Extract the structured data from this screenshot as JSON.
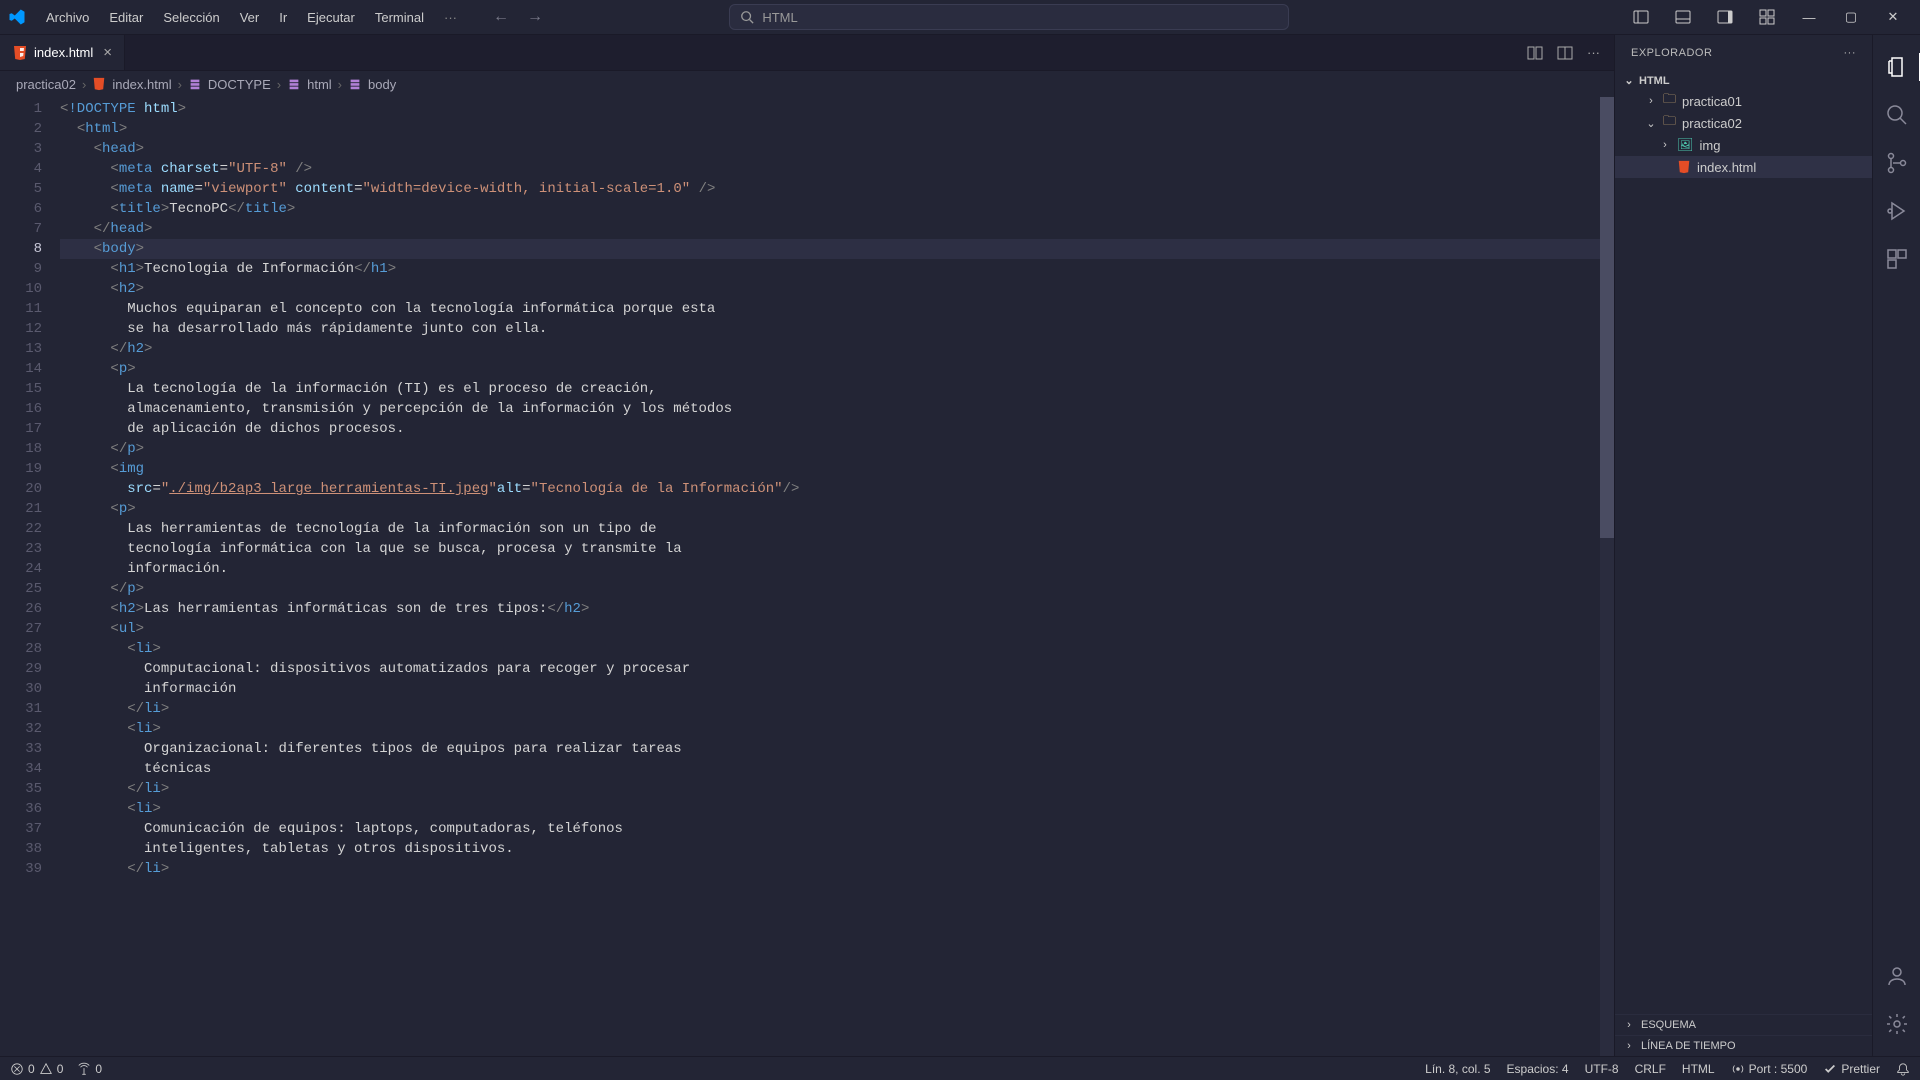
{
  "menu": [
    "Archivo",
    "Editar",
    "Selección",
    "Ver",
    "Ir",
    "Ejecutar",
    "Terminal"
  ],
  "search_placeholder": "HTML",
  "tab": {
    "name": "index.html"
  },
  "breadcrumb": [
    "practica02",
    "index.html",
    "DOCTYPE",
    "html",
    "body"
  ],
  "explorer": {
    "title": "EXPLORADOR",
    "root": "HTML",
    "items": [
      {
        "name": "practica01",
        "type": "folder",
        "expanded": false,
        "indent": 1
      },
      {
        "name": "practica02",
        "type": "folder",
        "expanded": true,
        "indent": 1
      },
      {
        "name": "img",
        "type": "folder-img",
        "expanded": false,
        "indent": 2
      },
      {
        "name": "index.html",
        "type": "html",
        "indent": 2,
        "selected": true
      }
    ],
    "esquema": "ESQUEMA",
    "linea_de_tiempo": "LÍNEA DE TIEMPO"
  },
  "status": {
    "errors": "0",
    "warnings": "0",
    "radio": "0",
    "position": "Lín. 8, col. 5",
    "spaces": "Espacios: 4",
    "encoding": "UTF-8",
    "eol": "CRLF",
    "lang": "HTML",
    "port": "Port : 5500",
    "prettier": "Prettier"
  },
  "code_lines": [
    {
      "n": 1,
      "i": 0,
      "t": [
        [
          "brk",
          "<"
        ],
        [
          "tag",
          "!DOCTYPE"
        ],
        [
          "txt",
          " "
        ],
        [
          "attr",
          "html"
        ],
        [
          "brk",
          ">"
        ]
      ]
    },
    {
      "n": 2,
      "i": 1,
      "t": [
        [
          "brk",
          "<"
        ],
        [
          "tag",
          "html"
        ],
        [
          "brk",
          ">"
        ]
      ]
    },
    {
      "n": 3,
      "i": 2,
      "t": [
        [
          "brk",
          "<"
        ],
        [
          "tag",
          "head"
        ],
        [
          "brk",
          ">"
        ]
      ]
    },
    {
      "n": 4,
      "i": 3,
      "t": [
        [
          "brk",
          "<"
        ],
        [
          "tag",
          "meta"
        ],
        [
          "txt",
          " "
        ],
        [
          "attr",
          "charset"
        ],
        [
          "txt",
          "="
        ],
        [
          "str",
          "\"UTF-8\""
        ],
        [
          "txt",
          " "
        ],
        [
          "brk",
          "/>"
        ]
      ]
    },
    {
      "n": 5,
      "i": 3,
      "t": [
        [
          "brk",
          "<"
        ],
        [
          "tag",
          "meta"
        ],
        [
          "txt",
          " "
        ],
        [
          "attr",
          "name"
        ],
        [
          "txt",
          "="
        ],
        [
          "str",
          "\"viewport\""
        ],
        [
          "txt",
          " "
        ],
        [
          "attr",
          "content"
        ],
        [
          "txt",
          "="
        ],
        [
          "str",
          "\"width=device-width, initial-scale=1.0\""
        ],
        [
          "txt",
          " "
        ],
        [
          "brk",
          "/>"
        ]
      ]
    },
    {
      "n": 6,
      "i": 3,
      "t": [
        [
          "brk",
          "<"
        ],
        [
          "tag",
          "title"
        ],
        [
          "brk",
          ">"
        ],
        [
          "txt",
          "TecnoPC"
        ],
        [
          "brk",
          "</"
        ],
        [
          "tag",
          "title"
        ],
        [
          "brk",
          ">"
        ]
      ]
    },
    {
      "n": 7,
      "i": 2,
      "t": [
        [
          "brk",
          "</"
        ],
        [
          "tag",
          "head"
        ],
        [
          "brk",
          ">"
        ]
      ]
    },
    {
      "n": 8,
      "i": 2,
      "hl": true,
      "t": [
        [
          "brk",
          "<"
        ],
        [
          "tag",
          "body"
        ],
        [
          "brk",
          ">"
        ]
      ]
    },
    {
      "n": 9,
      "i": 3,
      "t": [
        [
          "brk",
          "<"
        ],
        [
          "tag",
          "h1"
        ],
        [
          "brk",
          ">"
        ],
        [
          "txt",
          "Tecnologia de Información"
        ],
        [
          "brk",
          "</"
        ],
        [
          "tag",
          "h1"
        ],
        [
          "brk",
          ">"
        ]
      ]
    },
    {
      "n": 10,
      "i": 3,
      "t": [
        [
          "brk",
          "<"
        ],
        [
          "tag",
          "h2"
        ],
        [
          "brk",
          ">"
        ]
      ]
    },
    {
      "n": 11,
      "i": 4,
      "t": [
        [
          "txt",
          "Muchos equiparan el concepto con la tecnología informática porque esta"
        ]
      ]
    },
    {
      "n": 12,
      "i": 4,
      "t": [
        [
          "txt",
          "se ha desarrollado más rápidamente junto con ella."
        ]
      ]
    },
    {
      "n": 13,
      "i": 3,
      "t": [
        [
          "brk",
          "</"
        ],
        [
          "tag",
          "h2"
        ],
        [
          "brk",
          ">"
        ]
      ]
    },
    {
      "n": 14,
      "i": 3,
      "t": [
        [
          "brk",
          "<"
        ],
        [
          "tag",
          "p"
        ],
        [
          "brk",
          ">"
        ]
      ]
    },
    {
      "n": 15,
      "i": 4,
      "t": [
        [
          "txt",
          "La tecnología de la información (TI) es el proceso de creación,"
        ]
      ]
    },
    {
      "n": 16,
      "i": 4,
      "t": [
        [
          "txt",
          "almacenamiento, transmisión y percepción de la información y los métodos"
        ]
      ]
    },
    {
      "n": 17,
      "i": 4,
      "t": [
        [
          "txt",
          "de aplicación de dichos procesos."
        ]
      ]
    },
    {
      "n": 18,
      "i": 3,
      "t": [
        [
          "brk",
          "</"
        ],
        [
          "tag",
          "p"
        ],
        [
          "brk",
          ">"
        ]
      ]
    },
    {
      "n": 19,
      "i": 3,
      "t": [
        [
          "brk",
          "<"
        ],
        [
          "tag",
          "img"
        ]
      ]
    },
    {
      "n": 20,
      "i": 4,
      "t": [
        [
          "attr",
          "src"
        ],
        [
          "txt",
          "="
        ],
        [
          "str",
          "\""
        ],
        [
          "str-u",
          "./img/b2ap3_large_herramientas-TI.jpeg"
        ],
        [
          "str",
          "\""
        ],
        [
          "attr",
          "alt"
        ],
        [
          "txt",
          "="
        ],
        [
          "str",
          "\"Tecnología de la Información\""
        ],
        [
          "brk",
          "/>"
        ]
      ]
    },
    {
      "n": 21,
      "i": 3,
      "t": [
        [
          "brk",
          "<"
        ],
        [
          "tag",
          "p"
        ],
        [
          "brk",
          ">"
        ]
      ]
    },
    {
      "n": 22,
      "i": 4,
      "t": [
        [
          "txt",
          "Las herramientas de tecnología de la información son un tipo de"
        ]
      ]
    },
    {
      "n": 23,
      "i": 4,
      "t": [
        [
          "txt",
          "tecnología informática con la que se busca, procesa y transmite la"
        ]
      ]
    },
    {
      "n": 24,
      "i": 4,
      "t": [
        [
          "txt",
          "información."
        ]
      ]
    },
    {
      "n": 25,
      "i": 3,
      "t": [
        [
          "brk",
          "</"
        ],
        [
          "tag",
          "p"
        ],
        [
          "brk",
          ">"
        ]
      ]
    },
    {
      "n": 26,
      "i": 3,
      "t": [
        [
          "brk",
          "<"
        ],
        [
          "tag",
          "h2"
        ],
        [
          "brk",
          ">"
        ],
        [
          "txt",
          "Las herramientas informáticas son de tres tipos:"
        ],
        [
          "brk",
          "</"
        ],
        [
          "tag",
          "h2"
        ],
        [
          "brk",
          ">"
        ]
      ]
    },
    {
      "n": 27,
      "i": 3,
      "t": [
        [
          "brk",
          "<"
        ],
        [
          "tag",
          "ul"
        ],
        [
          "brk",
          ">"
        ]
      ]
    },
    {
      "n": 28,
      "i": 4,
      "t": [
        [
          "brk",
          "<"
        ],
        [
          "tag",
          "li"
        ],
        [
          "brk",
          ">"
        ]
      ]
    },
    {
      "n": 29,
      "i": 5,
      "t": [
        [
          "txt",
          "Computacional: dispositivos automatizados para recoger y procesar"
        ]
      ]
    },
    {
      "n": 30,
      "i": 5,
      "t": [
        [
          "txt",
          "información"
        ]
      ]
    },
    {
      "n": 31,
      "i": 4,
      "t": [
        [
          "brk",
          "</"
        ],
        [
          "tag",
          "li"
        ],
        [
          "brk",
          ">"
        ]
      ]
    },
    {
      "n": 32,
      "i": 4,
      "t": [
        [
          "brk",
          "<"
        ],
        [
          "tag",
          "li"
        ],
        [
          "brk",
          ">"
        ]
      ]
    },
    {
      "n": 33,
      "i": 5,
      "t": [
        [
          "txt",
          "Organizacional: diferentes tipos de equipos para realizar tareas"
        ]
      ]
    },
    {
      "n": 34,
      "i": 5,
      "t": [
        [
          "txt",
          "técnicas"
        ]
      ]
    },
    {
      "n": 35,
      "i": 4,
      "t": [
        [
          "brk",
          "</"
        ],
        [
          "tag",
          "li"
        ],
        [
          "brk",
          ">"
        ]
      ]
    },
    {
      "n": 36,
      "i": 4,
      "t": [
        [
          "brk",
          "<"
        ],
        [
          "tag",
          "li"
        ],
        [
          "brk",
          ">"
        ]
      ]
    },
    {
      "n": 37,
      "i": 5,
      "t": [
        [
          "txt",
          "Comunicación de equipos: laptops, computadoras, teléfonos"
        ]
      ]
    },
    {
      "n": 38,
      "i": 5,
      "t": [
        [
          "txt",
          "inteligentes, tabletas y otros dispositivos."
        ]
      ]
    },
    {
      "n": 39,
      "i": 4,
      "t": [
        [
          "brk",
          "</"
        ],
        [
          "tag",
          "li"
        ],
        [
          "brk",
          ">"
        ]
      ]
    }
  ]
}
